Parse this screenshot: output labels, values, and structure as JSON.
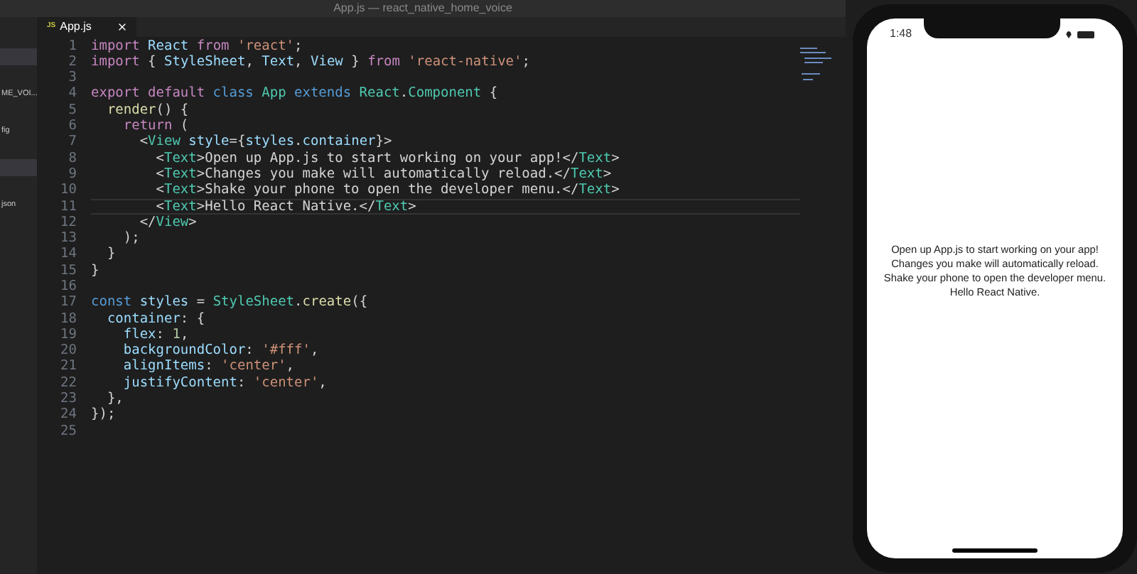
{
  "window": {
    "title": "App.js — react_native_home_voice"
  },
  "sidebar": {
    "items": [
      {
        "selected": true
      },
      {
        "label": "ME_VOI...",
        "selected": false
      },
      {
        "label": "fig",
        "selected": false
      },
      {
        "selected": true
      },
      {
        "label": "json",
        "selected": false
      }
    ]
  },
  "tabs": [
    {
      "badge": "JS",
      "label": "App.js",
      "selected": true
    }
  ],
  "editor": {
    "lines": [
      {
        "number": "1",
        "current": false,
        "tokens": [
          {
            "kind": "kw",
            "text": "import "
          },
          {
            "kind": "var",
            "text": "React "
          },
          {
            "kind": "kw",
            "text": "from "
          },
          {
            "kind": "str",
            "text": "'react'"
          },
          {
            "kind": "p",
            "text": ";"
          }
        ]
      },
      {
        "number": "2",
        "current": false,
        "tokens": [
          {
            "kind": "kw",
            "text": "import "
          },
          {
            "kind": "p",
            "text": "{ "
          },
          {
            "kind": "var",
            "text": "StyleSheet"
          },
          {
            "kind": "p",
            "text": ", "
          },
          {
            "kind": "var",
            "text": "Text"
          },
          {
            "kind": "p",
            "text": ", "
          },
          {
            "kind": "var",
            "text": "View"
          },
          {
            "kind": "p",
            "text": " } "
          },
          {
            "kind": "kw",
            "text": "from "
          },
          {
            "kind": "str",
            "text": "'react-native'"
          },
          {
            "kind": "p",
            "text": ";"
          }
        ]
      },
      {
        "number": "3",
        "current": false
      },
      {
        "number": "4",
        "current": false,
        "tokens": [
          {
            "kind": "kw",
            "text": "export default "
          },
          {
            "kind": "st",
            "text": "class "
          },
          {
            "kind": "cls",
            "text": "App "
          },
          {
            "kind": "st",
            "text": "extends "
          },
          {
            "kind": "cls",
            "text": "React"
          },
          {
            "kind": "p",
            "text": "."
          },
          {
            "kind": "cls",
            "text": "Component"
          },
          {
            "kind": "p",
            "text": " {"
          }
        ]
      },
      {
        "number": "5",
        "current": false,
        "tokens": [
          {
            "kind": "fn",
            "text": "  render"
          },
          {
            "kind": "p",
            "text": "() {"
          }
        ]
      },
      {
        "number": "6",
        "current": false,
        "tokens": [
          {
            "kind": "kw",
            "text": "    return"
          },
          {
            "kind": "p",
            "text": " ("
          }
        ]
      },
      {
        "number": "7",
        "current": false,
        "tokens": [
          {
            "kind": "p",
            "text": "      <"
          },
          {
            "kind": "tag",
            "text": "View "
          },
          {
            "kind": "var",
            "text": "style"
          },
          {
            "kind": "p",
            "text": "={"
          },
          {
            "kind": "var",
            "text": "styles"
          },
          {
            "kind": "p",
            "text": "."
          },
          {
            "kind": "var",
            "text": "container"
          },
          {
            "kind": "p",
            "text": "}>"
          }
        ]
      },
      {
        "number": "8",
        "current": false,
        "tokens": [
          {
            "kind": "p",
            "text": "        <"
          },
          {
            "kind": "tag",
            "text": "Text"
          },
          {
            "kind": "p",
            "text": ">Open up App.js to start working on your app!</"
          },
          {
            "kind": "tag",
            "text": "Text"
          },
          {
            "kind": "p",
            "text": ">"
          }
        ]
      },
      {
        "number": "9",
        "current": false,
        "tokens": [
          {
            "kind": "p",
            "text": "        <"
          },
          {
            "kind": "tag",
            "text": "Text"
          },
          {
            "kind": "p",
            "text": ">Changes you make will automatically reload.</"
          },
          {
            "kind": "tag",
            "text": "Text"
          },
          {
            "kind": "p",
            "text": ">"
          }
        ]
      },
      {
        "number": "10",
        "current": false,
        "tokens": [
          {
            "kind": "p",
            "text": "        <"
          },
          {
            "kind": "tag",
            "text": "Text"
          },
          {
            "kind": "p",
            "text": ">Shake your phone to open the developer menu.</"
          },
          {
            "kind": "tag",
            "text": "Text"
          },
          {
            "kind": "p",
            "text": ">"
          }
        ]
      },
      {
        "number": "11",
        "current": true,
        "tokens": [
          {
            "kind": "p",
            "text": "        <"
          },
          {
            "kind": "tag",
            "text": "Text"
          },
          {
            "kind": "p",
            "text": ">Hello React Native.</"
          },
          {
            "kind": "tag",
            "text": "Text"
          },
          {
            "kind": "p",
            "text": ">"
          }
        ]
      },
      {
        "number": "12",
        "current": false,
        "tokens": [
          {
            "kind": "p",
            "text": "      </"
          },
          {
            "kind": "tag",
            "text": "View"
          },
          {
            "kind": "p",
            "text": ">"
          }
        ]
      },
      {
        "number": "13",
        "current": false,
        "tokens": [
          {
            "kind": "p",
            "text": "    );"
          }
        ]
      },
      {
        "number": "14",
        "current": false,
        "tokens": [
          {
            "kind": "p",
            "text": "  }"
          }
        ]
      },
      {
        "number": "15",
        "current": false,
        "tokens": [
          {
            "kind": "p",
            "text": "}"
          }
        ]
      },
      {
        "number": "16",
        "current": false
      },
      {
        "number": "17",
        "current": false,
        "tokens": [
          {
            "kind": "st",
            "text": "const "
          },
          {
            "kind": "var",
            "text": "styles "
          },
          {
            "kind": "p",
            "text": "= "
          },
          {
            "kind": "cls",
            "text": "StyleSheet"
          },
          {
            "kind": "p",
            "text": "."
          },
          {
            "kind": "fn",
            "text": "create"
          },
          {
            "kind": "p",
            "text": "({"
          }
        ]
      },
      {
        "number": "18",
        "current": false,
        "tokens": [
          {
            "kind": "var",
            "text": "  container"
          },
          {
            "kind": "p",
            "text": ": {"
          }
        ]
      },
      {
        "number": "19",
        "current": false,
        "tokens": [
          {
            "kind": "var",
            "text": "    flex"
          },
          {
            "kind": "p",
            "text": ": "
          },
          {
            "kind": "num",
            "text": "1"
          },
          {
            "kind": "p",
            "text": ","
          }
        ]
      },
      {
        "number": "20",
        "current": false,
        "tokens": [
          {
            "kind": "var",
            "text": "    backgroundColor"
          },
          {
            "kind": "p",
            "text": ": "
          },
          {
            "kind": "str",
            "text": "'#fff'"
          },
          {
            "kind": "p",
            "text": ","
          }
        ]
      },
      {
        "number": "21",
        "current": false,
        "tokens": [
          {
            "kind": "var",
            "text": "    alignItems"
          },
          {
            "kind": "p",
            "text": ": "
          },
          {
            "kind": "str",
            "text": "'center'"
          },
          {
            "kind": "p",
            "text": ","
          }
        ]
      },
      {
        "number": "22",
        "current": false,
        "tokens": [
          {
            "kind": "var",
            "text": "    justifyContent"
          },
          {
            "kind": "p",
            "text": ": "
          },
          {
            "kind": "str",
            "text": "'center'"
          },
          {
            "kind": "p",
            "text": ","
          }
        ]
      },
      {
        "number": "23",
        "current": false,
        "tokens": [
          {
            "kind": "p",
            "text": "  },"
          }
        ]
      },
      {
        "number": "24",
        "current": false,
        "tokens": [
          {
            "kind": "p",
            "text": "});"
          }
        ]
      },
      {
        "number": "25",
        "current": false
      }
    ]
  },
  "phone": {
    "time": "1:48",
    "screen_lines": [
      "Open up App.js to start working on your app!",
      "Changes you make will automatically reload.",
      "Shake your phone to open the developer menu.",
      "Hello React Native."
    ]
  }
}
